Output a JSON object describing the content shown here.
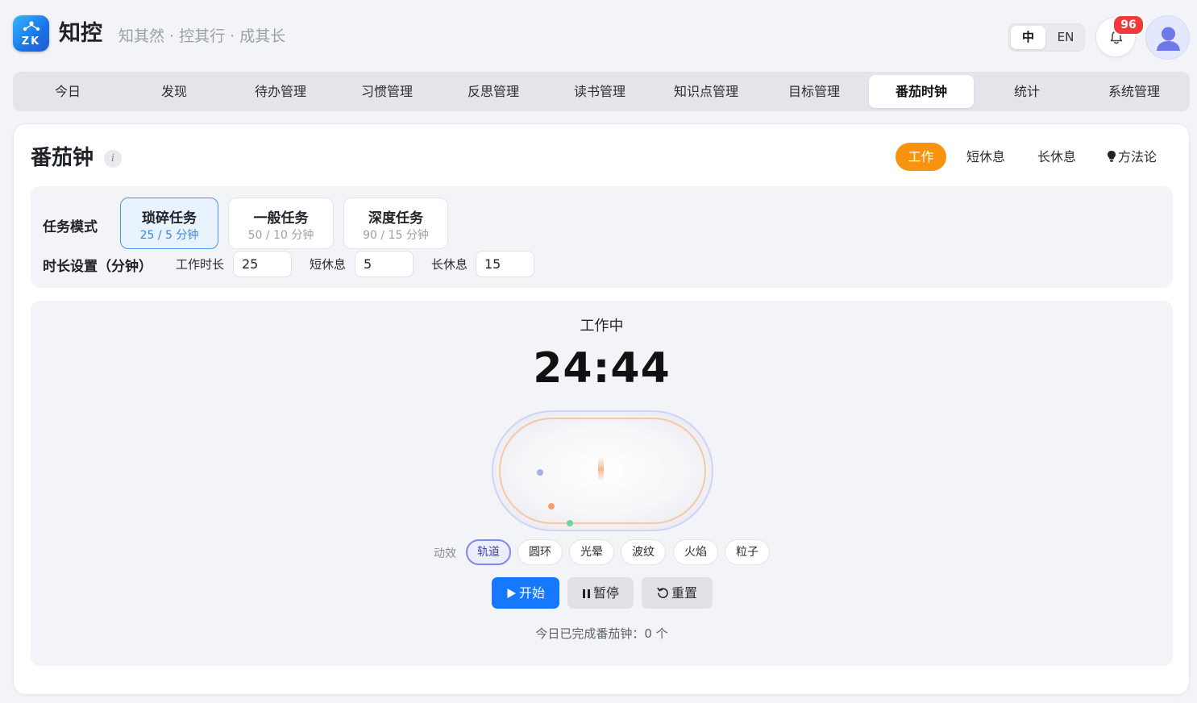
{
  "header": {
    "logo_text": "ZK",
    "title": "知控",
    "slogan": "知其然 · 控其行 · 成其长",
    "lang": {
      "zh": "中",
      "en": "EN"
    },
    "notification_count": "96"
  },
  "nav": {
    "items": [
      "今日",
      "发现",
      "待办管理",
      "习惯管理",
      "反思管理",
      "读书管理",
      "知识点管理",
      "目标管理",
      "番茄时钟",
      "统计",
      "系统管理"
    ],
    "active": "番茄时钟"
  },
  "pomodoro": {
    "title": "番茄钟",
    "info_icon": "i",
    "mode_tabs": [
      "工作",
      "短休息",
      "长休息"
    ],
    "active_mode": "工作",
    "method_label": "方法论",
    "task_mode_label": "任务模式",
    "task_cards": [
      {
        "name": "琐碎任务",
        "sub": "25 / 5 分钟"
      },
      {
        "name": "一般任务",
        "sub": "50 / 10 分钟"
      },
      {
        "name": "深度任务",
        "sub": "90 / 15 分钟"
      }
    ],
    "duration_label": "时长设置（分钟）",
    "work_label": "工作时长",
    "work_value": "25",
    "short_label": "短休息",
    "short_value": "5",
    "long_label": "长休息",
    "long_value": "15",
    "status": "工作中",
    "time": "24:44",
    "fx_label": "动效",
    "fx_options": [
      "轨道",
      "圆环",
      "光晕",
      "波纹",
      "火焰",
      "粒子"
    ],
    "active_fx": "轨道",
    "start_label": "开始",
    "pause_label": "暂停",
    "reset_label": "重置",
    "today_completed": "今日已完成番茄钟：0 个"
  },
  "colors": {
    "primary_blue": "#1677ff",
    "accent_orange": "#f7930c",
    "badge_red": "#ef3b3b",
    "orbit_purple": "#a6adf2",
    "orbit_orange": "#f6c9a6"
  }
}
